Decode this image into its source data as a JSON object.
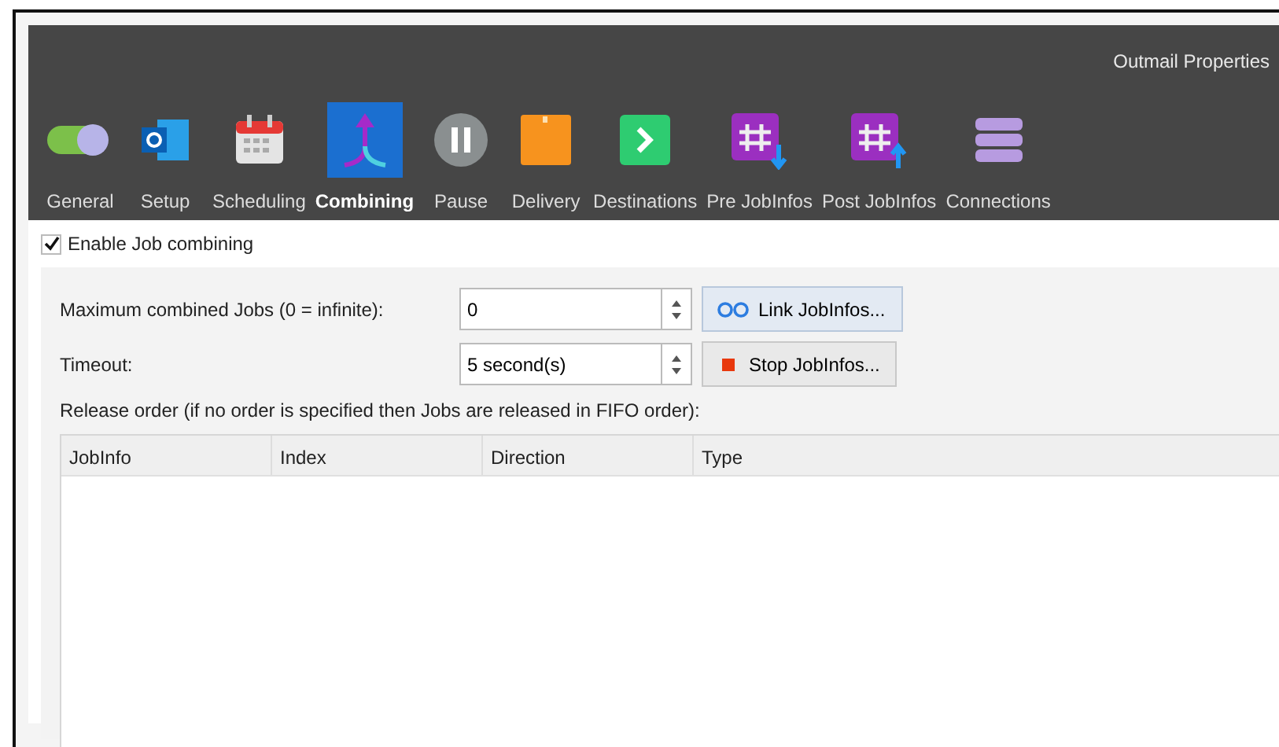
{
  "window": {
    "title": "Outmail Properties"
  },
  "toolbar": [
    {
      "label": "General",
      "kind": "toggle",
      "selected": false
    },
    {
      "label": "Setup",
      "kind": "mail",
      "selected": false
    },
    {
      "label": "Scheduling",
      "kind": "calendar",
      "selected": false
    },
    {
      "label": "Combining",
      "kind": "merge",
      "selected": true
    },
    {
      "label": "Pause",
      "kind": "pause",
      "selected": false
    },
    {
      "label": "Delivery",
      "kind": "box",
      "selected": false
    },
    {
      "label": "Destinations",
      "kind": "chevron",
      "selected": false
    },
    {
      "label": "Pre JobInfos",
      "kind": "hash-down",
      "selected": false
    },
    {
      "label": "Post JobInfos",
      "kind": "hash-up",
      "selected": false
    },
    {
      "label": "Connections",
      "kind": "stack",
      "selected": false
    }
  ],
  "enable": {
    "label": "Enable Job combining",
    "checked": true
  },
  "fields": [
    {
      "label": "Maximum combined Jobs (0 = infinite):",
      "value": "0",
      "button": "Link JobInfos...",
      "kind": "link"
    },
    {
      "label": "Timeout:",
      "value": "5 second(s)",
      "button": "Stop JobInfos...",
      "kind": "stop"
    }
  ],
  "release_note": "Release order (if no order is specified then Jobs are released in FIFO order):",
  "table": {
    "columns": [
      "JobInfo",
      "Index",
      "Direction",
      "Type"
    ]
  }
}
